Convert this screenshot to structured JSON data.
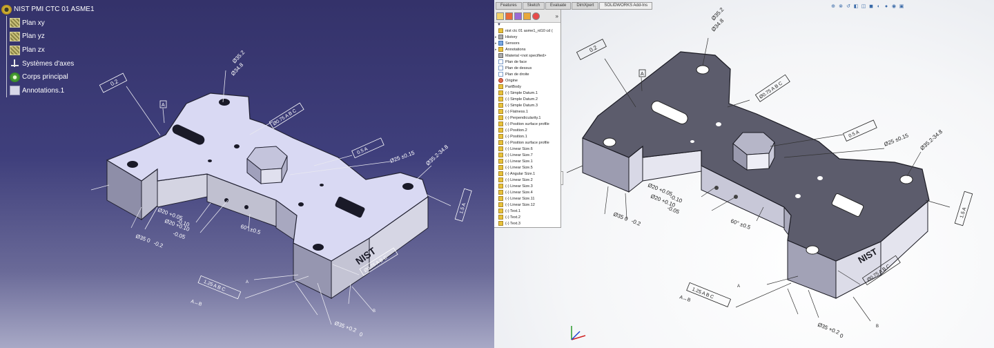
{
  "catia": {
    "tree": {
      "root": "NIST PMI CTC 01 ASME1",
      "items": [
        {
          "label": "Plan xy",
          "icon": "plane-icon"
        },
        {
          "label": "Plan yz",
          "icon": "plane-icon"
        },
        {
          "label": "Plan zx",
          "icon": "plane-icon"
        },
        {
          "label": "Systèmes d'axes",
          "icon": "axis-system-icon"
        },
        {
          "label": "Corps principal",
          "icon": "body-icon"
        },
        {
          "label": "Annotations.1",
          "icon": "annotations-icon"
        }
      ]
    },
    "annotations": {
      "flatness": "0.2",
      "datum_a": "A",
      "diam_top": "Ø35.2",
      "diam_top_2": "Ø34.8",
      "pos_top": "Ø0.75 A B C",
      "perp": "0.5 A",
      "diam_25": "Ø25 ±0.15",
      "diam_range": "Ø35.2-34.8",
      "parallel": "1.5 A",
      "diam_20a": "Ø20 +0.05",
      "diam_20a_tol": "-0.10",
      "diam_20b": "Ø20 +0.10",
      "diam_20b_tol": "-0.05",
      "angle": "60° ±0.5",
      "diam_35": "Ø35 0",
      "diam_35_tol": "-0.2",
      "pos_bottom": "Ø0.75 A B C",
      "profile": "1.25 A B C",
      "arrow_label": "A↔B",
      "diam_35b": "Ø35 +0.2",
      "diam_35b_tol": "0",
      "label_a": "A",
      "label_b": "B",
      "logo": "NIST"
    }
  },
  "solidworks": {
    "tabs": [
      "Features",
      "Sketch",
      "Evaluate",
      "DimXpert",
      "SOLIDWORKS Add-Ins"
    ],
    "filter": "▼",
    "tree": [
      {
        "label": "nist ctc 01 asme1_rd10 cd (",
        "icon": "y"
      },
      {
        "label": "History",
        "icon": "g"
      },
      {
        "label": "Sensors",
        "icon": "b"
      },
      {
        "label": "Annotations",
        "icon": "y"
      },
      {
        "label": "Material <not specified>",
        "icon": "g"
      },
      {
        "label": "Plan de face",
        "icon": "p"
      },
      {
        "label": "Plan de dessus",
        "icon": "p"
      },
      {
        "label": "Plan de droite",
        "icon": "p"
      },
      {
        "label": "Origine",
        "icon": "r"
      },
      {
        "label": "PartBody",
        "icon": "y"
      },
      {
        "label": "(-) Simple Datum.1",
        "icon": "y"
      },
      {
        "label": "(-) Simple Datum.2",
        "icon": "y"
      },
      {
        "label": "(-) Simple Datum.3",
        "icon": "y"
      },
      {
        "label": "(-) Flatness.1",
        "icon": "y"
      },
      {
        "label": "(-) Perpendicularity.1",
        "icon": "y"
      },
      {
        "label": "(-) Position surface profile",
        "icon": "y"
      },
      {
        "label": "(-) Position.2",
        "icon": "y"
      },
      {
        "label": "(-) Position.1",
        "icon": "y"
      },
      {
        "label": "(-) Position surface profile",
        "icon": "y"
      },
      {
        "label": "(-) Linear Size.6",
        "icon": "y"
      },
      {
        "label": "(-) Linear Size.7",
        "icon": "y"
      },
      {
        "label": "(-) Linear Size.1",
        "icon": "y"
      },
      {
        "label": "(-) Linear Size.5",
        "icon": "y"
      },
      {
        "label": "(-) Angular Size.1",
        "icon": "y"
      },
      {
        "label": "(-) Linear Size.2",
        "icon": "y"
      },
      {
        "label": "(-) Linear Size.3",
        "icon": "y"
      },
      {
        "label": "(-) Linear Size.4",
        "icon": "y"
      },
      {
        "label": "(-) Linear Size.11",
        "icon": "y"
      },
      {
        "label": "(-) Linear Size.12",
        "icon": "y"
      },
      {
        "label": "(-) Text.1",
        "icon": "y"
      },
      {
        "label": "(-) Text.2",
        "icon": "y"
      },
      {
        "label": "(-) Text.3",
        "icon": "y"
      }
    ],
    "more": "»",
    "annotations": {
      "flatness": "0.2",
      "datum_a": "A",
      "diam_top": "Ø35.2",
      "diam_top_2": "Ø34.8",
      "pos_top": "Ø0.75 A B C",
      "perp": "0.5 A",
      "diam_25": "Ø25 ±0.15",
      "diam_range": "Ø35.2-34.8",
      "parallel": "1.5 A",
      "diam_20a": "Ø20 +0.05",
      "diam_20a_tol": "-0.10",
      "diam_20b": "Ø20 +0.10",
      "diam_20b_tol": "-0.05",
      "angle": "60° ±0.5",
      "diam_35": "Ø35 0",
      "diam_35_tol": "-0.2",
      "pos_bottom": "Ø0.75 A B C",
      "profile": "1.25 A B C",
      "arrow_label": "A↔B",
      "diam_35b": "Ø35 +0.2",
      "diam_35b_tol": "0",
      "label_a": "A",
      "label_b": "B",
      "logo": "NIST"
    }
  }
}
